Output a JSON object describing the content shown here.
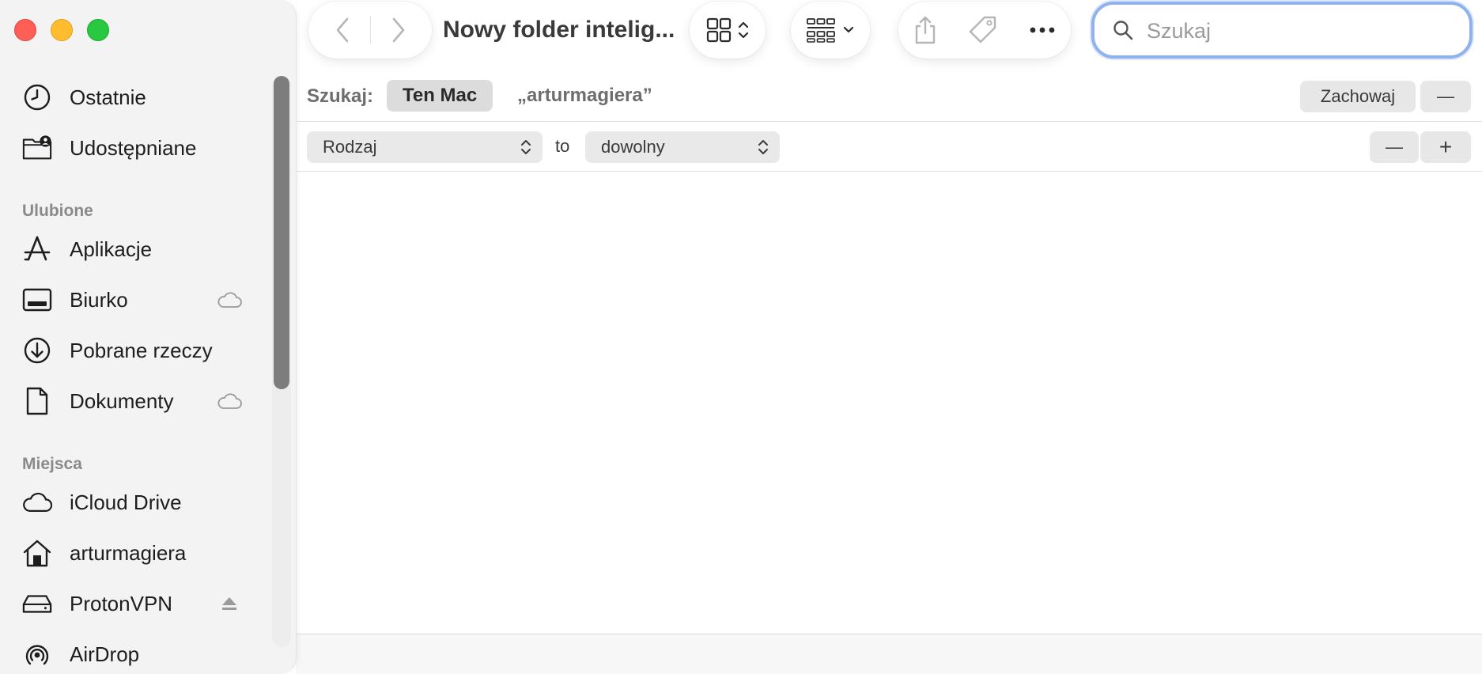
{
  "window": {
    "title": "Nowy folder intelig..."
  },
  "sidebar": {
    "items": [
      {
        "label": "Ostatnie",
        "icon": "clock-icon"
      },
      {
        "label": "Udostępniane",
        "icon": "shared-folder-icon"
      }
    ],
    "sections": [
      {
        "heading": "Ulubione",
        "items": [
          {
            "label": "Aplikacje",
            "icon": "applications-icon"
          },
          {
            "label": "Biurko",
            "icon": "desktop-icon",
            "trailing": "icloud-icon"
          },
          {
            "label": "Pobrane rzeczy",
            "icon": "download-icon"
          },
          {
            "label": "Dokumenty",
            "icon": "document-icon",
            "trailing": "icloud-icon"
          }
        ]
      },
      {
        "heading": "Miejsca",
        "items": [
          {
            "label": "iCloud Drive",
            "icon": "cloud-icon"
          },
          {
            "label": "arturmagiera",
            "icon": "home-icon"
          },
          {
            "label": "ProtonVPN",
            "icon": "drive-icon",
            "trailing": "eject-icon"
          },
          {
            "label": "AirDrop",
            "icon": "airdrop-icon"
          }
        ]
      }
    ]
  },
  "search": {
    "placeholder": "Szukaj",
    "value": ""
  },
  "scope": {
    "label": "Szukaj:",
    "options": [
      "Ten Mac",
      "„arturmagiera”"
    ],
    "selected": "Ten Mac",
    "save_label": "Zachowaj",
    "remove_label": "—"
  },
  "criteria": {
    "attribute": "Rodzaj",
    "connector": "to",
    "value": "dowolny",
    "remove_label": "—",
    "add_label": "+"
  },
  "colors": {
    "accent": "#8fb2ee",
    "close": "#ff5f57",
    "minimize": "#febc2e",
    "maximize": "#28c840"
  }
}
